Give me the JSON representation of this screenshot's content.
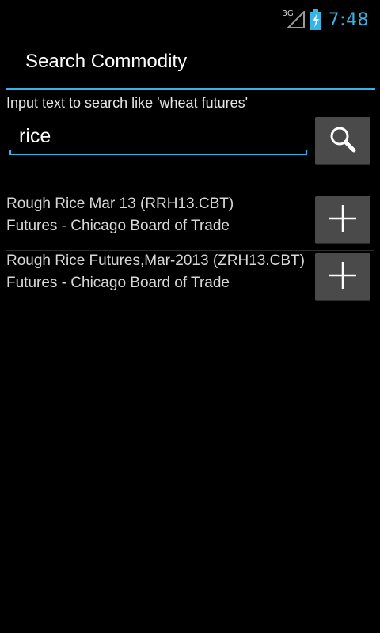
{
  "status_bar": {
    "network_type": "3G",
    "time": "7:48",
    "icons": [
      "signal-icon",
      "battery-charging-icon"
    ]
  },
  "action_bar": {
    "title": "Search Commodity"
  },
  "search": {
    "hint": "Input text to search like 'wheat futures'",
    "value": "rice",
    "button_icon": "search-icon"
  },
  "results": [
    {
      "name": "Rough Rice Mar 13 (RRH13.CBT)",
      "detail": "Futures - Chicago Board of Trade",
      "button_icon": "plus-icon"
    },
    {
      "name": "Rough Rice Futures,Mar-2013 (ZRH13.CBT)",
      "detail": "Futures - Chicago Board of Trade",
      "button_icon": "plus-icon"
    }
  ],
  "colors": {
    "accent": "#33b5e5",
    "background": "#000000",
    "button": "#4a4a4a"
  }
}
